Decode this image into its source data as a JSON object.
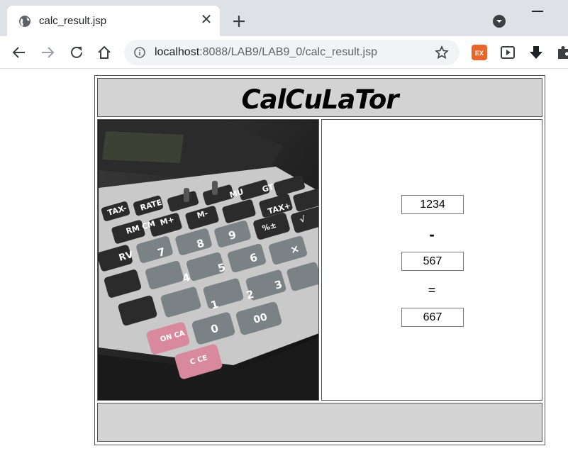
{
  "browser": {
    "tab_title": "calc_result.jsp",
    "tab_close": "✕",
    "url_host": "localhost",
    "url_rest": ":8088/LAB9/LAB9_0/calc_result.jsp",
    "extension_label": "EX"
  },
  "page": {
    "title": "CalCuLaTor",
    "operand1": "1234",
    "operator": "-",
    "operand2": "567",
    "equals": "=",
    "result": "667",
    "calculator_keys": [
      "RATE",
      "GT",
      "MU",
      "M-",
      "M+",
      "RM CM",
      "TAX+",
      "TAX-",
      "8",
      "9",
      "%±",
      "√",
      "7",
      "5",
      "6",
      "×",
      "4",
      "3",
      "2",
      "1",
      "RV",
      "00",
      "0",
      "ON CA",
      "C CE"
    ]
  }
}
